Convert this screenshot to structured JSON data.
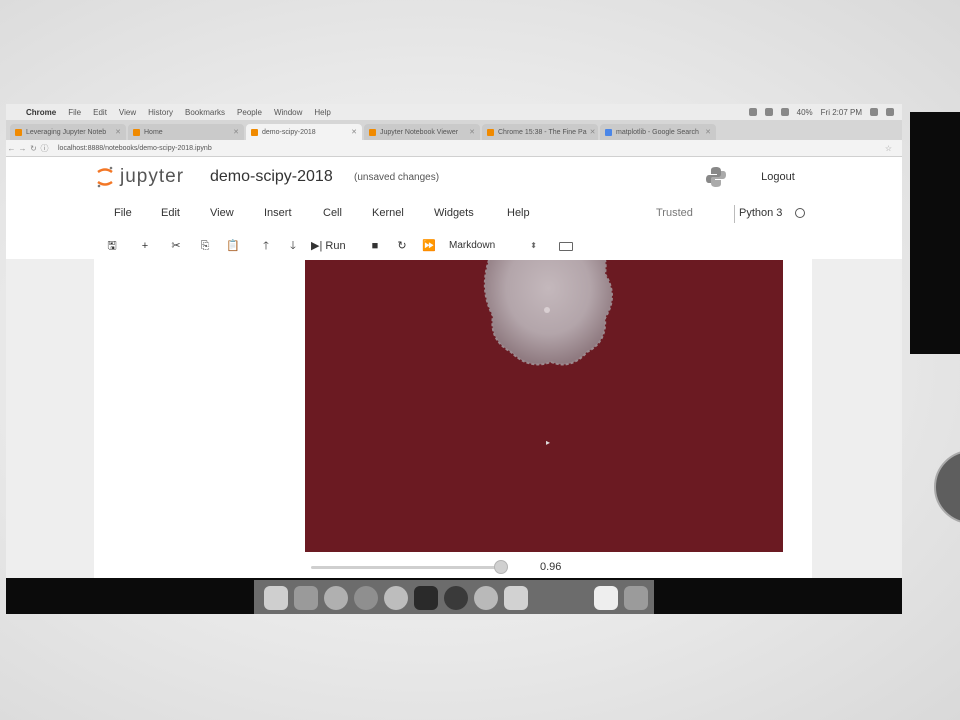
{
  "mac_menubar": {
    "apple_glyph": "",
    "items": [
      "Chrome",
      "File",
      "Edit",
      "View",
      "History",
      "Bookmarks",
      "People",
      "Window",
      "Help"
    ],
    "battery": "40%",
    "clock": "Fri 2:07 PM"
  },
  "tabs": [
    {
      "label": "Leveraging Jupyter Noteb"
    },
    {
      "label": "Home"
    },
    {
      "label": "demo-scipy-2018"
    },
    {
      "label": "Jupyter Notebook Viewer"
    },
    {
      "label": "Chrome 15:38 - The Fine Pa"
    },
    {
      "label": "matplotlib - Google Search"
    }
  ],
  "address": {
    "url": "localhost:8888/notebooks/demo-scipy-2018.ipynb"
  },
  "jupyter": {
    "logo_text": "jupyter",
    "notebook_name": "demo-scipy-2018",
    "save_status": "(unsaved changes)",
    "logout_label": "Logout",
    "menus": [
      "File",
      "Edit",
      "View",
      "Insert",
      "Cell",
      "Kernel",
      "Widgets",
      "Help"
    ],
    "trusted": "Trusted",
    "kernel": "Python 3",
    "toolbar": {
      "save": "🖫",
      "add": "+",
      "cut": "✂",
      "copy": "⎘",
      "paste": "📋",
      "up": "🡑",
      "down": "🡓",
      "run_label": "Run",
      "run_glyph": "▶|",
      "stop": "■",
      "restart": "↻",
      "fast_forward": "⏩",
      "cell_type": "Markdown",
      "cell_type_arrow": "⬍"
    },
    "slider": {
      "value_label": "0.96",
      "value": 0.96
    },
    "colors": {
      "viz_background": "#6b1a22",
      "blob": "#b5a9ad"
    }
  },
  "dock": {
    "apps": [
      "Finder",
      "Launchpad",
      "App Store",
      "Safari",
      "Photos",
      "Terminal",
      "Spotify",
      "Messages",
      "Slack",
      "Preview",
      "Trash"
    ]
  }
}
